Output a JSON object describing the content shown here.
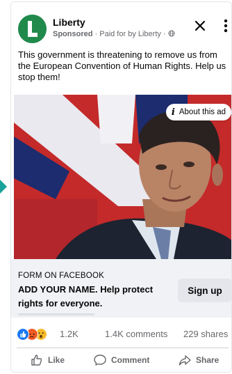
{
  "ad": {
    "page_name": "Liberty",
    "sponsored_label": "Sponsored",
    "paid_by": "· Paid for by Liberty ·",
    "globe_icon": "globe-icon",
    "post_text": "This government is threatening to remove us from the European Convention of Human Rights. Help us stop them!",
    "about_ad_label": "About this ad",
    "form_label": "FORM ON FACEBOOK",
    "headline": "ADD YOUR NAME. Help protect rights for everyone.",
    "cta_label": "Sign up"
  },
  "stats": {
    "reactions": "1.2K",
    "comments": "1.4K comments",
    "shares": "229 shares"
  },
  "actions": {
    "like": "Like",
    "comment": "Comment",
    "share": "Share"
  },
  "colors": {
    "brand_green": "#1f8a4c",
    "like_blue": "#1877f2",
    "angry_orange": "#f05a24",
    "wow_yellow": "#f7b928",
    "teal_arrow": "#1aa39a"
  }
}
